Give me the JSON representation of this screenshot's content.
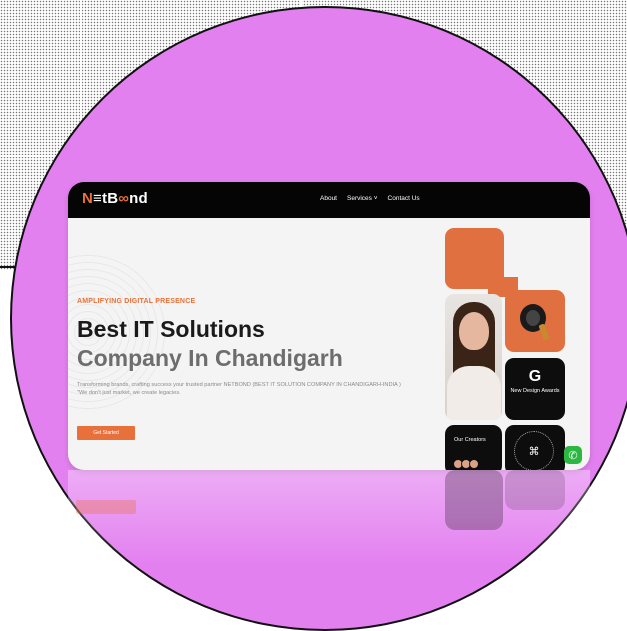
{
  "site": {
    "logo": "NetBond",
    "logo_display_a": "N",
    "logo_display_b": "≡tB",
    "logo_display_c": "∞",
    "logo_display_d": "nd"
  },
  "nav": {
    "items": [
      {
        "label": "About"
      },
      {
        "label": "Services ˅"
      },
      {
        "label": "Contact Us"
      }
    ]
  },
  "hero": {
    "tagline": "AMPLIFYING DIGITAL PRESENCE",
    "headline_line1": "Best IT Solutions",
    "headline_line2": "Company In Chandigarh",
    "description_line1": "Transforming brands, crafting success your trusted partner NETBOND (BEST IT SOLUTION COMPANY IN CHANDIGARH-INDIA )",
    "description_line2": "\"We don't just market, we create legacies.",
    "cta_label": "Get Started"
  },
  "cards": {
    "awards_label": "New Design Awards",
    "awards_icon": "G",
    "creators_label": "Our Creators",
    "badge_icon": "⌘",
    "whatsapp_icon": "✆"
  },
  "colors": {
    "accent": "#e8703a",
    "background_blob": "#e380f0",
    "nav": "#050505",
    "whatsapp": "#2bb741"
  }
}
